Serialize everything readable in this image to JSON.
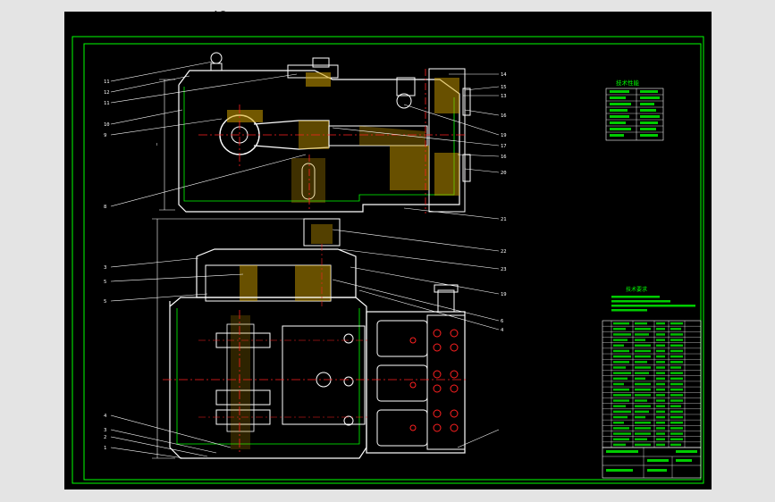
{
  "window": {
    "title": "AO"
  },
  "colors": {
    "paper": "#000000",
    "frame": "#00ff00",
    "geometry": "#ffffff",
    "centerline": "#ff2020",
    "section": "#d0a000"
  },
  "drawing": {
    "view_top": {
      "callouts_left": [
        "11",
        "12",
        "11",
        "10",
        "9",
        "8"
      ],
      "callouts_right": [
        "14",
        "15",
        "13",
        "16",
        "19",
        "17",
        "16",
        "20",
        "21"
      ]
    },
    "view_bottom": {
      "callouts_left": [
        "3",
        "5",
        "5",
        "4",
        "3",
        "2",
        "1"
      ],
      "callouts_right": [
        "22",
        "23",
        "19",
        "6",
        "4"
      ]
    },
    "tech_table": {
      "title": "技术性能",
      "rows": [
        "",
        "",
        "",
        "",
        "",
        "",
        "",
        ""
      ]
    },
    "tech_requirements": {
      "title": "技术要求",
      "lines": [
        "",
        "",
        "",
        ""
      ]
    },
    "parts_list": {
      "rows": [
        "",
        "",
        "",
        "",
        "",
        "",
        "",
        "",
        "",
        "",
        "",
        "",
        "",
        "",
        "",
        "",
        "",
        "",
        "",
        "",
        "",
        "",
        ""
      ]
    }
  }
}
